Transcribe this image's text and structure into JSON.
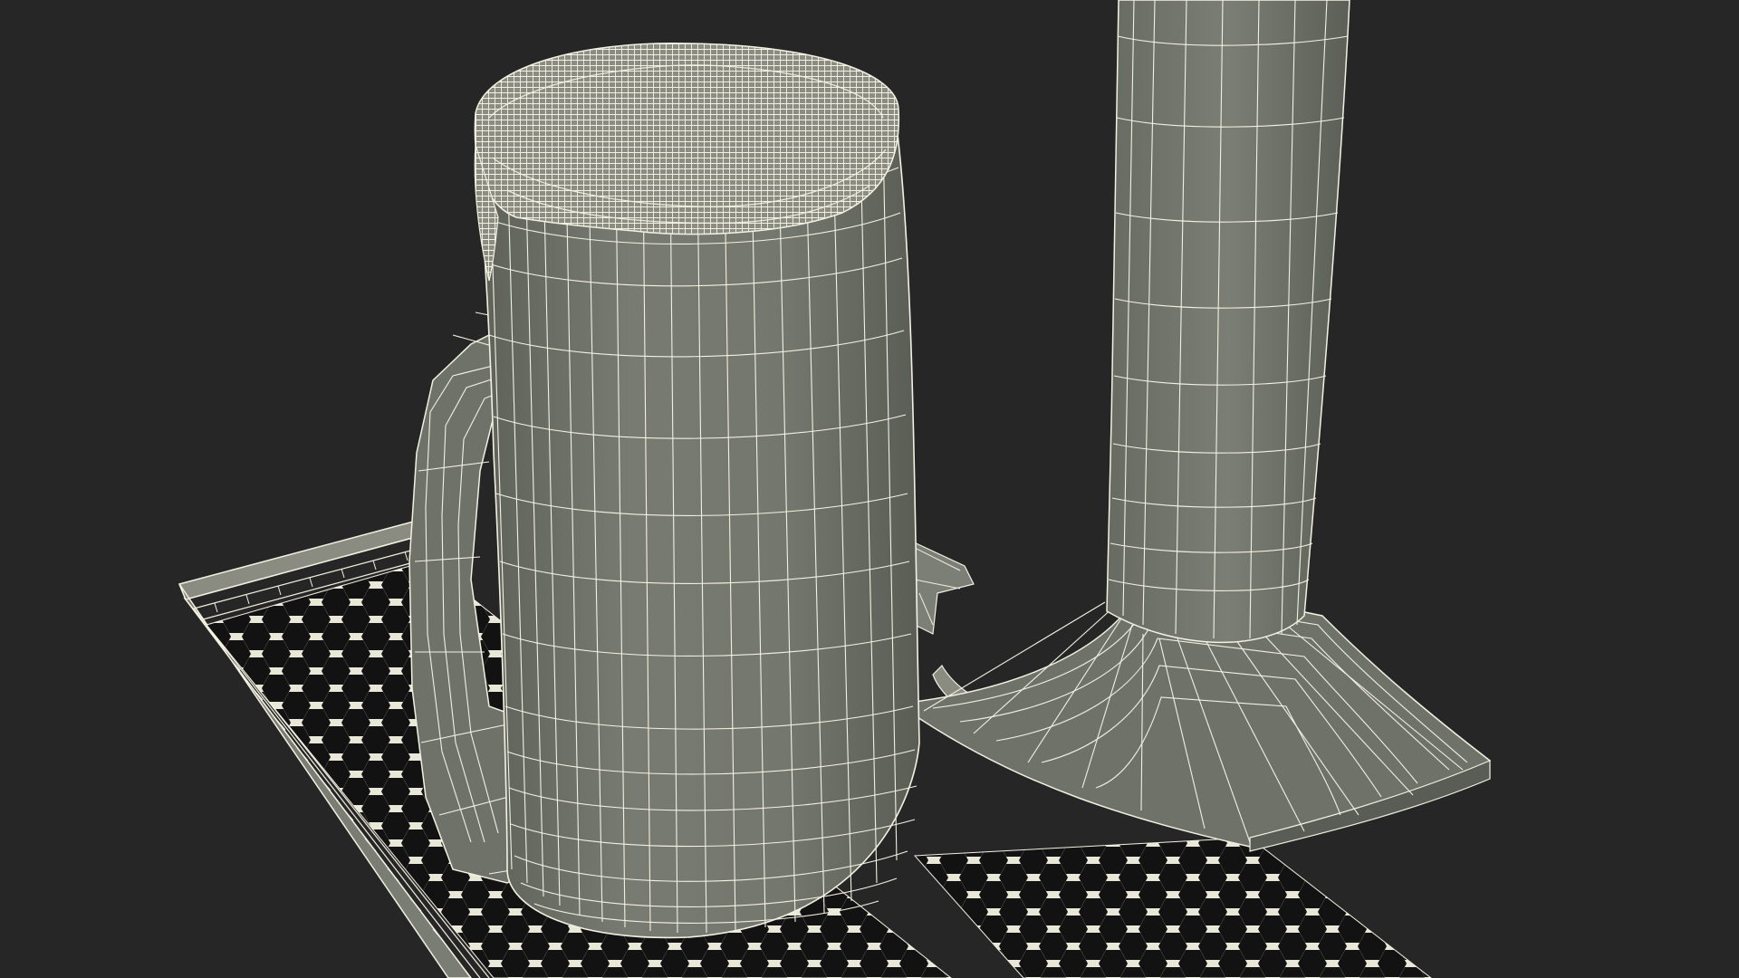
{
  "scene": {
    "kind": "3d-wireframe-render",
    "objects": [
      "beer-mug",
      "foam-head",
      "beer-tap-tower",
      "drip-tray"
    ],
    "colors": {
      "background": "#262626",
      "surface": "#70736a",
      "surface_dark": "#4d5048",
      "surface_light": "#878a80",
      "wire": "#f3f1e2",
      "hole": "#0f0f0f"
    }
  }
}
